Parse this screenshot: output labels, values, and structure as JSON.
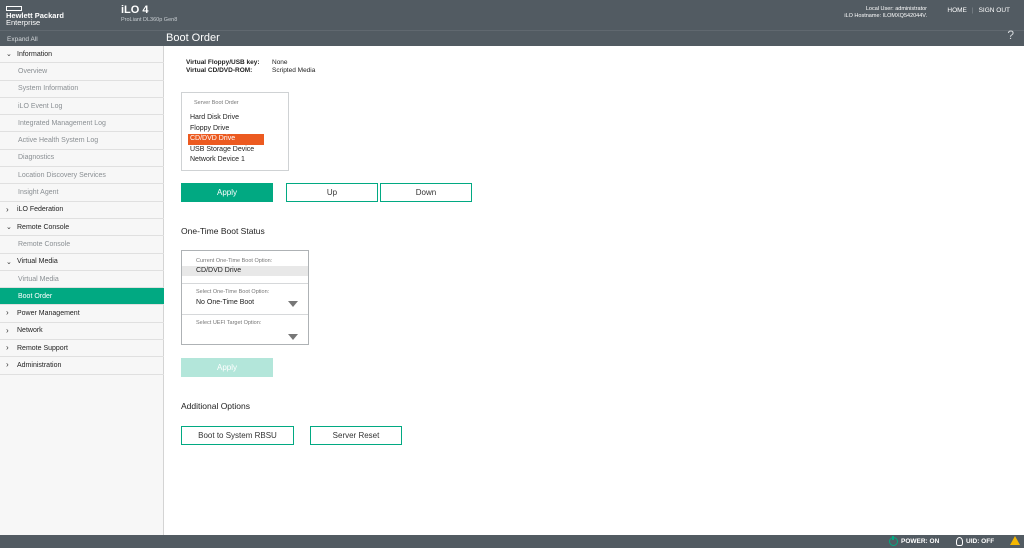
{
  "header": {
    "brand_line1": "Hewlett Packard",
    "brand_line2": "Enterprise",
    "product": "iLO 4",
    "server_model": "ProLiant DL360p Gen8",
    "local_user": "Local User: administrator",
    "hostname": "iLO Hostname: ILOMXQ542044V.",
    "home_label": "HOME",
    "signout_label": "SIGN OUT",
    "separator": "|"
  },
  "subbar": {
    "expand_all": "Expand All",
    "page_title": "Boot Order",
    "help": "?"
  },
  "sidebar": {
    "items": [
      {
        "label": "Information",
        "type": "section",
        "state": "expanded"
      },
      {
        "label": "Overview",
        "type": "sub"
      },
      {
        "label": "System Information",
        "type": "sub"
      },
      {
        "label": "iLO Event Log",
        "type": "sub"
      },
      {
        "label": "Integrated Management Log",
        "type": "sub"
      },
      {
        "label": "Active Health System Log",
        "type": "sub"
      },
      {
        "label": "Diagnostics",
        "type": "sub"
      },
      {
        "label": "Location Discovery Services",
        "type": "sub"
      },
      {
        "label": "Insight Agent",
        "type": "sub"
      },
      {
        "label": "iLO Federation",
        "type": "section",
        "state": "collapsed"
      },
      {
        "label": "Remote Console",
        "type": "section",
        "state": "expanded"
      },
      {
        "label": "Remote Console",
        "type": "sub"
      },
      {
        "label": "Virtual Media",
        "type": "section",
        "state": "expanded"
      },
      {
        "label": "Virtual Media",
        "type": "sub"
      },
      {
        "label": "Boot Order",
        "type": "sub",
        "active": true
      },
      {
        "label": "Power Management",
        "type": "section",
        "state": "collapsed"
      },
      {
        "label": "Network",
        "type": "section",
        "state": "collapsed"
      },
      {
        "label": "Remote Support",
        "type": "section",
        "state": "collapsed"
      },
      {
        "label": "Administration",
        "type": "section",
        "state": "collapsed"
      }
    ]
  },
  "virtual_media": {
    "floppy_label": "Virtual Floppy/USB key:",
    "floppy_value": "None",
    "cdrom_label": "Virtual CD/DVD-ROM:",
    "cdrom_value": "Scripted Media"
  },
  "server_boot_order": {
    "label": "Server Boot Order",
    "items": [
      "Hard Disk Drive",
      "Floppy Drive",
      "CD/DVD Drive",
      "USB Storage Device",
      "Network Device 1"
    ],
    "selected_index": 2,
    "apply_label": "Apply",
    "up_label": "Up",
    "down_label": "Down"
  },
  "one_time_boot": {
    "title": "One-Time Boot Status",
    "current_label": "Current One-Time Boot Option:",
    "current_value": "CD/DVD Drive",
    "select_label": "Select One-Time Boot Option:",
    "select_value": "No One-Time Boot",
    "uefi_label": "Select UEFI Target Option:",
    "uefi_value": "",
    "apply_label": "Apply"
  },
  "additional": {
    "title": "Additional Options",
    "rbsu_label": "Boot to System RBSU",
    "reset_label": "Server Reset"
  },
  "footer": {
    "power": "POWER: ON",
    "uid": "UID: OFF"
  },
  "colors": {
    "accent": "#01a982",
    "selected": "#ec5a20",
    "header": "#525b62",
    "warning": "#f5b700"
  }
}
